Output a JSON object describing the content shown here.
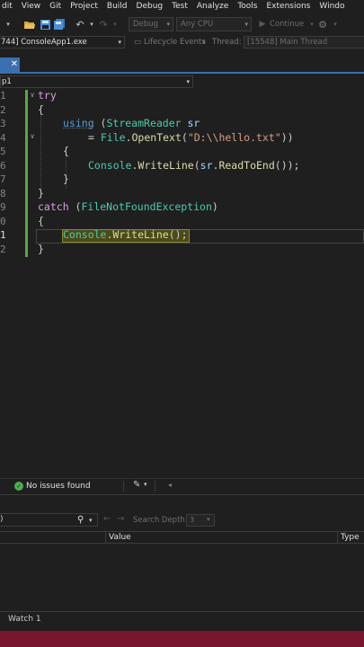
{
  "menu": [
    "dit",
    "View",
    "Git",
    "Project",
    "Build",
    "Debug",
    "Test",
    "Analyze",
    "Tools",
    "Extensions",
    "Windo"
  ],
  "toolbar": {
    "config": "Debug",
    "platform": "Any CPU",
    "continue_label": "Continue",
    "icons": [
      "dropdown-arrow",
      "open-folder",
      "save",
      "save-all",
      "undo",
      "redo",
      "continue-play",
      "settings"
    ]
  },
  "debug_location": {
    "process": "744] ConsoleApp1.exe",
    "lifecycle_label": "Lifecycle Events",
    "thread_label": "Thread:",
    "thread_value": "[15548] Main Thread"
  },
  "tab": {
    "close_glyph": "✕"
  },
  "navbar": {
    "scope": "p1"
  },
  "code": {
    "line_numbers": [
      "1",
      "2",
      "3",
      "4",
      "5",
      "6",
      "7",
      "8",
      "9",
      "0",
      "1",
      "2"
    ],
    "lines": {
      "l1_try": "try",
      "l2_brace": "{",
      "l3_using": "using",
      "l3_paren": " (",
      "l3_type": "StreamReader",
      "l3_var": " sr",
      "l4_eq": "= ",
      "l4_type": "File",
      "l4_dot": ".",
      "l4_fn": "OpenText",
      "l4_open": "(",
      "l4_str": "\"D:\\\\hello.txt\"",
      "l4_close": "))",
      "l5_brace": "{",
      "l6_type": "Console",
      "l6_dot": ".",
      "l6_fn": "WriteLine",
      "l6_open": "(",
      "l6_var": "sr",
      "l6_dot2": ".",
      "l6_fn2": "ReadToEnd",
      "l6_close": "());",
      "l7_brace": "}",
      "l8_brace": "}",
      "l9_catch": "catch",
      "l9_paren": " (",
      "l9_type": "FileNotFoundException",
      "l9_close": ")",
      "l10_brace": "{",
      "l11_type": "Console",
      "l11_dot": ".",
      "l11_fn": "WriteLine",
      "l11_close": "();",
      "l12_brace": "}"
    }
  },
  "editor_status": {
    "issues": "No issues found"
  },
  "watch": {
    "search_value": ")",
    "search_depth_label": "Search Depth:",
    "search_depth_value": "3",
    "columns": [
      "Value",
      "Type"
    ],
    "tab_label": "Watch 1"
  },
  "colors": {
    "statusbar": "#7a1530",
    "accent": "#3a6fb0",
    "keyword": "#569cd6",
    "control_keyword": "#d8a0df",
    "type": "#4ec9b0",
    "method": "#dcdcaa",
    "string": "#d69d85"
  }
}
